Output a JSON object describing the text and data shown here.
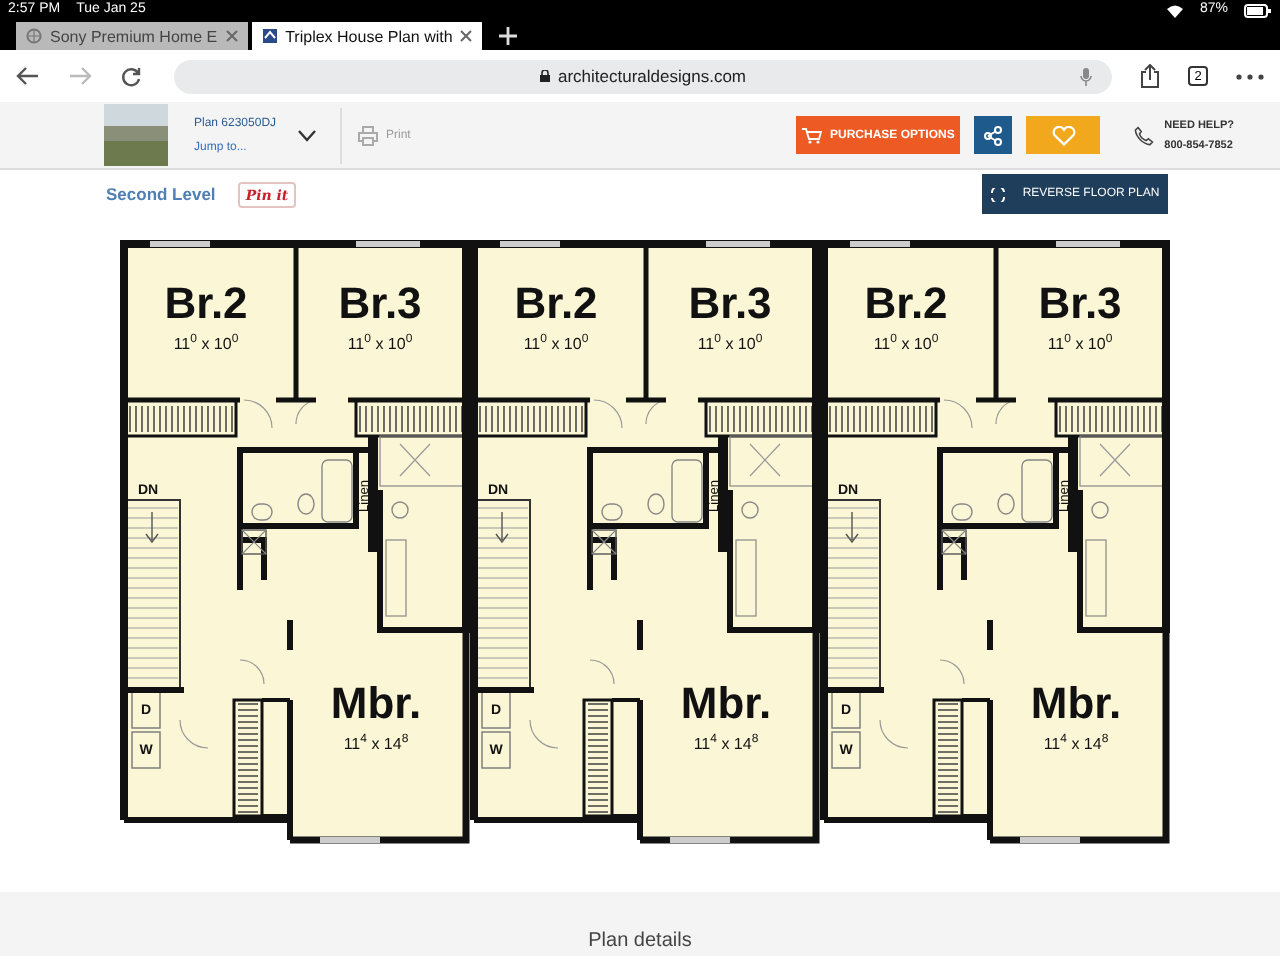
{
  "status_bar": {
    "time": "2:57 PM",
    "date": "Tue Jan 25",
    "battery": "87%"
  },
  "tabs": [
    {
      "title": "Sony Premium Home E",
      "selected": false
    },
    {
      "title": "Triplex House Plan with",
      "selected": true
    }
  ],
  "address_bar": {
    "url": "architecturaldesigns.com",
    "tab_count": "2"
  },
  "site_header": {
    "plan_number": "Plan 623050DJ",
    "jump_link": "Jump to...",
    "print": "Print",
    "purchase_button": "PURCHASE OPTIONS",
    "help_title": "NEED HELP?",
    "help_phone": "800-854-7852"
  },
  "plan_toolbar": {
    "level_title": "Second Level",
    "pin_button": "Pin it",
    "reverse_button": "REVERSE FLOOR PLAN"
  },
  "floor_plan": {
    "units": [
      {
        "rooms": [
          {
            "name": "Br.2",
            "size": "11$^{0}$ x 10$^{0}$"
          },
          {
            "name": "Br.3",
            "size": "11$^{0}$ x 10$^{0}$"
          },
          {
            "name": "Mbr.",
            "size": "11$^{4}$ x 14$^{8}$"
          }
        ],
        "stair_label": "DN",
        "closet_label": "Linen",
        "laundry_labels": [
          "D",
          "W"
        ]
      },
      {
        "rooms": [
          {
            "name": "Br.2",
            "size": "11$^{0}$ x 10$^{0}$"
          },
          {
            "name": "Br.3",
            "size": "11$^{0}$ x 10$^{0}$"
          },
          {
            "name": "Mbr.",
            "size": "11$^{4}$ x 14$^{8}$"
          }
        ],
        "stair_label": "DN",
        "closet_label": "Linen",
        "laundry_labels": [
          "D",
          "W"
        ]
      },
      {
        "rooms": [
          {
            "name": "Br.2",
            "size": "11$^{0}$ x 10$^{0}$"
          },
          {
            "name": "Br.3",
            "size": "11$^{0}$ x 10$^{0}$"
          },
          {
            "name": "Mbr.",
            "size": "11$^{4}$ x 14$^{8}$"
          }
        ],
        "stair_label": "DN",
        "closet_label": "Linen",
        "laundry_labels": [
          "D",
          "W"
        ]
      }
    ]
  },
  "footer": {
    "title": "Plan details"
  }
}
